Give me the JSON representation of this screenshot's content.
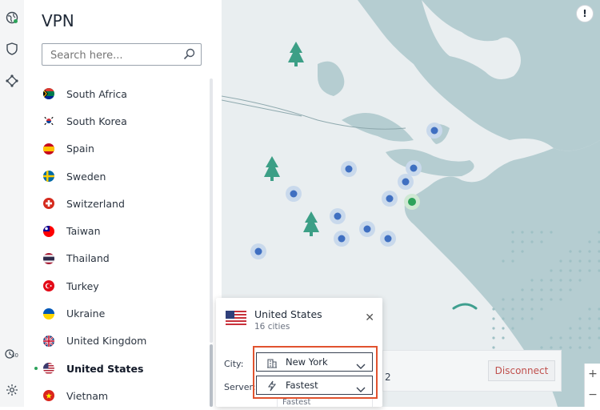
{
  "panel": {
    "title": "VPN",
    "search_placeholder": "Search here..."
  },
  "countries": [
    {
      "name": "South Africa",
      "flag": "za"
    },
    {
      "name": "South Korea",
      "flag": "kr"
    },
    {
      "name": "Spain",
      "flag": "es"
    },
    {
      "name": "Sweden",
      "flag": "se"
    },
    {
      "name": "Switzerland",
      "flag": "ch"
    },
    {
      "name": "Taiwan",
      "flag": "tw"
    },
    {
      "name": "Thailand",
      "flag": "th"
    },
    {
      "name": "Turkey",
      "flag": "tr"
    },
    {
      "name": "Ukraine",
      "flag": "ua"
    },
    {
      "name": "United Kingdom",
      "flag": "gb"
    },
    {
      "name": "United States",
      "flag": "us",
      "active": true
    },
    {
      "name": "Vietnam",
      "flag": "vn"
    }
  ],
  "rail": {
    "badge": "40"
  },
  "popup": {
    "country": "United States",
    "subtitle": "16 cities",
    "city_label": "City:",
    "city_value": "New York",
    "server_label": "Server:",
    "server_value": "Fastest",
    "peek_option": "Fastest"
  },
  "status": {
    "partial_number": "2",
    "disconnect_label": "Disconnect"
  },
  "map": {
    "alert_label": "!",
    "zoom_in": "+",
    "zoom_out": "−"
  },
  "colors": {
    "accent_green": "#2ca25a",
    "server_dot": "#3f6fc1",
    "highlight": "#e1532f",
    "disconnect_text": "#c0504d",
    "sea": "#b5cdd1",
    "land": "#e9eef0"
  }
}
